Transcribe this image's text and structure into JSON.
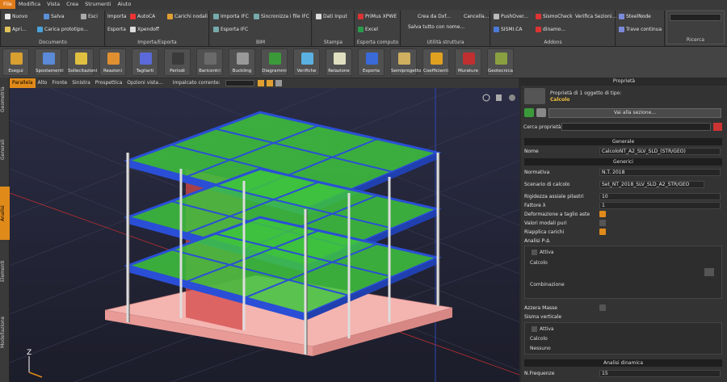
{
  "menu": [
    "File",
    "Modifica",
    "Vista",
    "Crea",
    "Strumenti",
    "Aiuto"
  ],
  "ribbon": {
    "documento": {
      "title": "Documento",
      "items": [
        "Nuovo",
        "Salva",
        "Esci",
        "Apri...",
        "Carica prototipo..."
      ]
    },
    "importa": {
      "title": "Importa/Esporta",
      "items": [
        "Importa",
        "AutoCA",
        "Carichi nodali",
        "Esporta",
        "Xpendoff"
      ]
    },
    "bim": {
      "title": "BIM",
      "items": [
        "Importa IFC",
        "Sincronizza i file IFC",
        "Esporta IFC"
      ]
    },
    "stampa": {
      "title": "Stampa",
      "items": [
        "Dati Input"
      ]
    },
    "esporta": {
      "title": "Esporta computo",
      "items": [
        "PriMus XPWE",
        "Excel"
      ]
    },
    "utilita": {
      "title": "Utilità struttura",
      "items": [
        "Crea da Dxf...",
        "Cancella...",
        "Salva tutto con nome..."
      ]
    },
    "addons": {
      "title": "Addons",
      "items": [
        "PushOver...",
        "SismoCheck",
        "Verifica Sezioni...",
        "SISMI.CA",
        "dinamo..."
      ]
    },
    "ricerca": {
      "title": "Ricerca",
      "items": [
        "SteelNode",
        "Trave continua"
      ]
    }
  },
  "tools": [
    "Esegui",
    "Spostamenti",
    "Sollecitazioni",
    "Reazioni",
    "Tagliarti",
    "Periodi",
    "Baricentri",
    "Buckling",
    "Diagrammi",
    "Verifiche",
    "Relazione",
    "Esporta",
    "Semiprogetto",
    "Coefficienti",
    "Murature",
    "Geotecnica"
  ],
  "side_tabs": [
    "Geometria",
    "Generali",
    "Analisi",
    "Elementi",
    "Modellazione"
  ],
  "view_tabs": [
    "Parallela",
    "Alto",
    "Fronte",
    "Sinistra",
    "Prospettica",
    "Opzioni vista..."
  ],
  "impalcato_label": "Impalcato corrente:",
  "panel": {
    "title": "Proprietà",
    "header_line1": "Proprietà di 1 oggetto di tipo:",
    "header_type": "Calcolo",
    "goto_button": "Vai alla sezione...",
    "search_label": "Cerca proprietà:",
    "sec_generale": "Generale",
    "nome_label": "Nome",
    "nome_val": "CalcoloNT_A2_SLV_SLD_(STR/GEO)",
    "sec_generici": "Generici",
    "normativa_label": "Normativa",
    "normativa_val": "N.T. 2018",
    "scenario_label": "Scenario di calcolo",
    "scenario_val": "Set_NT_2018_SLV_SLD_A2_STR/GEO",
    "rig_label": "Rigidezza assiale pilastri",
    "rig_val": "10",
    "fattore_label": "Fattore λ",
    "fattore_val": "1",
    "deform_label": "Deformazione a taglio aste",
    "modali_label": "Valori modali puri",
    "ricarichi_label": "Riapplica carichi",
    "pdelta_label": "Analisi P-Δ",
    "attiva": "Attiva",
    "calcolo": "Calcolo",
    "combinazione": "Combinazione",
    "azzera_label": "Azzera Masse",
    "sisma_label": "Sisma verticale",
    "attiva2": "Attiva",
    "calcolo2": "Calcolo",
    "nessuno": "Nessuno",
    "sec_dinamica": "Analisi dinamica",
    "nfreq_label": "N.Frequenze",
    "nfreq_val": "15"
  },
  "colors": {
    "accent": "#e08a1a",
    "slab": "#3ec43e",
    "beam": "#2a4fd6",
    "base": "#f4b4b0",
    "wall": "#d44a4a"
  }
}
